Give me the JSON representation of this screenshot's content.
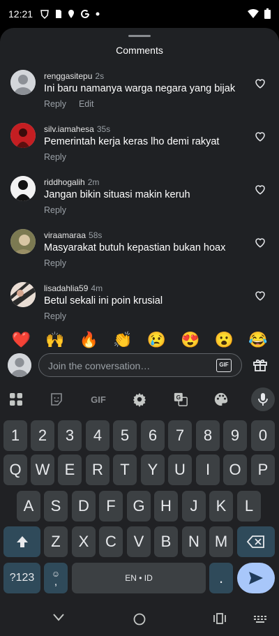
{
  "status": {
    "time": "12:21"
  },
  "sheet": {
    "title": "Comments"
  },
  "comments": [
    {
      "user": "renggasitepu",
      "time": "2s",
      "text": "Ini baru namanya warga negara yang bijak",
      "reply": "Reply",
      "edit": "Edit"
    },
    {
      "user": "silv.iamahesa",
      "time": "35s",
      "text": "Pemerintah kerja keras lho demi rakyat",
      "reply": "Reply"
    },
    {
      "user": "riddhogalih",
      "time": "2m",
      "text": "Jangan bikin situasi makin keruh",
      "reply": "Reply"
    },
    {
      "user": "viraamaraa",
      "time": "58s",
      "text": "Masyarakat butuh kepastian bukan hoax",
      "reply": "Reply"
    },
    {
      "user": "lisadahlia59",
      "time": "4m",
      "text": "Betul sekali ini poin krusial",
      "reply": "Reply"
    }
  ],
  "emojis": [
    "❤️",
    "🙌",
    "🔥",
    "👏",
    "😢",
    "😍",
    "😮",
    "😂"
  ],
  "compose": {
    "placeholder": "Join the conversation…",
    "gif_label": "GIF"
  },
  "keyboard": {
    "toolbar_gif": "GIF",
    "row_numbers": [
      "1",
      "2",
      "3",
      "4",
      "5",
      "6",
      "7",
      "8",
      "9",
      "0"
    ],
    "row_q": [
      "Q",
      "W",
      "E",
      "R",
      "T",
      "Y",
      "U",
      "I",
      "O",
      "P"
    ],
    "row_a": [
      "A",
      "S",
      "D",
      "F",
      "G",
      "H",
      "J",
      "K",
      "L"
    ],
    "row_z": [
      "Z",
      "X",
      "C",
      "V",
      "B",
      "N",
      "M"
    ],
    "symbols_label": "?123",
    "emoji_comma": ",",
    "space_label": "EN • ID",
    "period_label": "."
  },
  "colors": {
    "sheet_bg": "#1f2124",
    "keyboard_bg": "#202124",
    "key_bg": "#3c4043",
    "heart_red": "#e8352e"
  }
}
